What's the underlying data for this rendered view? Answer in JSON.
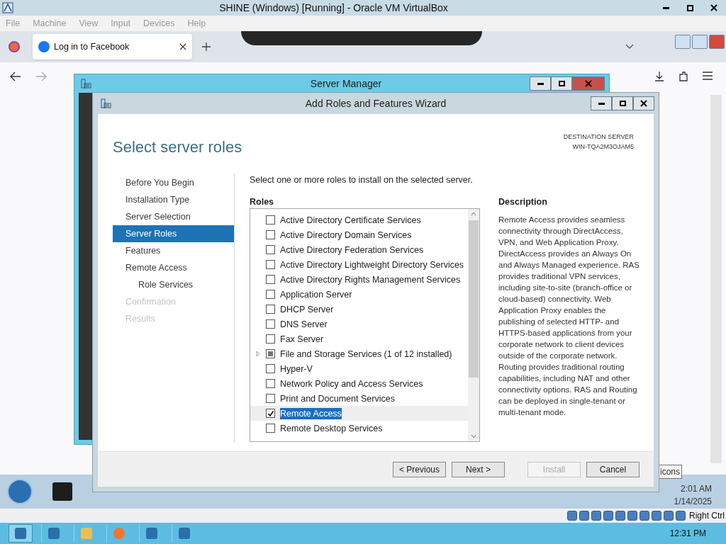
{
  "host_window": {
    "title": "SHINE (Windows) [Running] - Oracle VM VirtualBox",
    "menu": [
      "File",
      "Machine",
      "View",
      "Input",
      "Devices",
      "Help"
    ]
  },
  "browser": {
    "tabs": [
      {
        "label": "Log in to Facebook",
        "selected": true
      }
    ]
  },
  "server_manager": {
    "title": "Server Manager"
  },
  "wizard": {
    "title": "Add Roles and Features Wizard",
    "heading": "Select server roles",
    "destination_label": "DESTINATION SERVER",
    "destination_server": "WIN-TQA2M3OJAM5",
    "steps": [
      {
        "label": "Before You Begin",
        "selected": false,
        "disabled": false
      },
      {
        "label": "Installation Type",
        "selected": false,
        "disabled": false
      },
      {
        "label": "Server Selection",
        "selected": false,
        "disabled": false
      },
      {
        "label": "Server Roles",
        "selected": true,
        "disabled": false
      },
      {
        "label": "Features",
        "selected": false,
        "disabled": false
      },
      {
        "label": "Remote Access",
        "selected": false,
        "disabled": false,
        "children": [
          {
            "label": "Role Services",
            "selected": false,
            "disabled": false
          }
        ]
      },
      {
        "label": "Confirmation",
        "selected": false,
        "disabled": true
      },
      {
        "label": "Results",
        "selected": false,
        "disabled": true
      }
    ],
    "instruction": "Select one or more roles to install on the selected server.",
    "roles_label": "Roles",
    "roles": [
      {
        "label": "Active Directory Certificate Services",
        "checked": false,
        "partial": false,
        "expandable": false,
        "selected": false
      },
      {
        "label": "Active Directory Domain Services",
        "checked": false,
        "partial": false,
        "expandable": false,
        "selected": false
      },
      {
        "label": "Active Directory Federation Services",
        "checked": false,
        "partial": false,
        "expandable": false,
        "selected": false
      },
      {
        "label": "Active Directory Lightweight Directory Services",
        "checked": false,
        "partial": false,
        "expandable": false,
        "selected": false
      },
      {
        "label": "Active Directory Rights Management Services",
        "checked": false,
        "partial": false,
        "expandable": false,
        "selected": false
      },
      {
        "label": "Application Server",
        "checked": false,
        "partial": false,
        "expandable": false,
        "selected": false
      },
      {
        "label": "DHCP Server",
        "checked": false,
        "partial": false,
        "expandable": false,
        "selected": false
      },
      {
        "label": "DNS Server",
        "checked": false,
        "partial": false,
        "expandable": false,
        "selected": false
      },
      {
        "label": "Fax Server",
        "checked": false,
        "partial": false,
        "expandable": false,
        "selected": false
      },
      {
        "label": "File and Storage Services (1 of 12 installed)",
        "checked": false,
        "partial": true,
        "expandable": true,
        "selected": false
      },
      {
        "label": "Hyper-V",
        "checked": false,
        "partial": false,
        "expandable": false,
        "selected": false
      },
      {
        "label": "Network Policy and Access Services",
        "checked": false,
        "partial": false,
        "expandable": false,
        "selected": false
      },
      {
        "label": "Print and Document Services",
        "checked": false,
        "partial": false,
        "expandable": false,
        "selected": false
      },
      {
        "label": "Remote Access",
        "checked": true,
        "partial": false,
        "expandable": false,
        "selected": true
      },
      {
        "label": "Remote Desktop Services",
        "checked": false,
        "partial": false,
        "expandable": false,
        "selected": false
      }
    ],
    "description_label": "Description",
    "description": "Remote Access provides seamless connectivity through DirectAccess, VPN, and Web Application Proxy. DirectAccess provides an Always On and Always Managed experience. RAS provides traditional VPN services, including site-to-site (branch-office or cloud-based) connectivity. Web Application Proxy enables the publishing of selected HTTP- and HTTPS-based applications from your corporate network to client devices outside of the corporate network. Routing provides traditional routing capabilities, including NAT and other connectivity options. RAS and Routing can be deployed in single-tenant or multi-tenant mode.",
    "buttons": [
      {
        "label": "< Previous",
        "disabled": false
      },
      {
        "label": "Next >",
        "disabled": false
      },
      {
        "label": "Install",
        "disabled": true
      },
      {
        "label": "Cancel",
        "disabled": false
      }
    ]
  },
  "guest_taskbar": {
    "tooltip": "icons",
    "time": "2:01 AM",
    "date": "1/14/2025"
  },
  "vbox_status": {
    "host_key": "Right Ctrl"
  },
  "host_taskbar": {
    "time": "12:31 PM"
  }
}
